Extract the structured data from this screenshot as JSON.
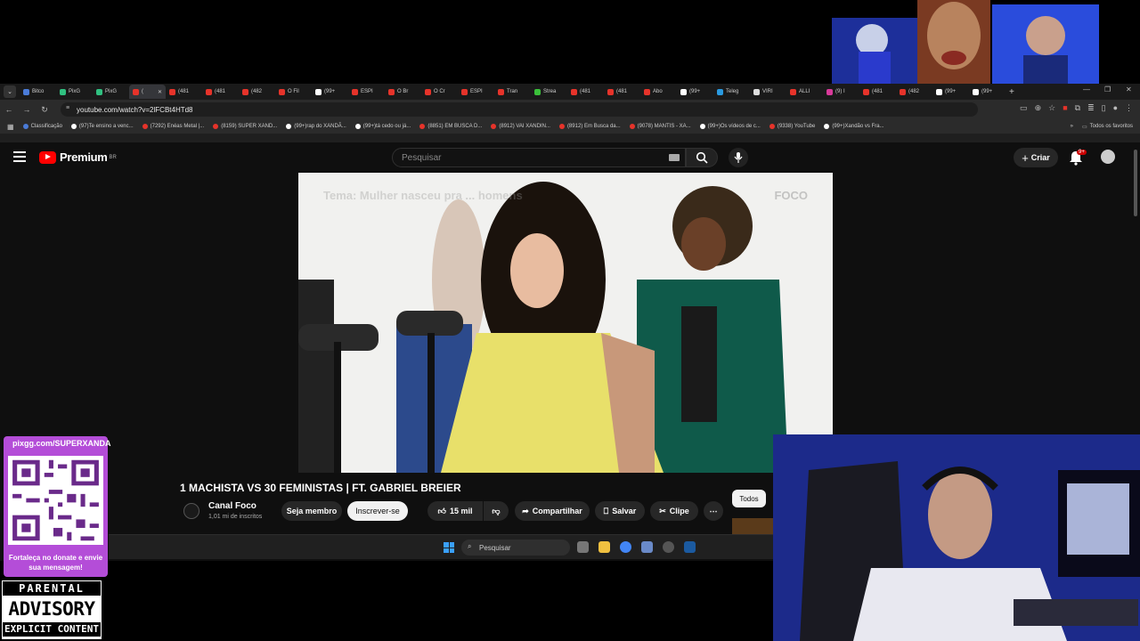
{
  "browser": {
    "tabs": [
      {
        "label": "Bitco",
        "color": "#4a7bd8"
      },
      {
        "label": "PixG",
        "color": "#30c080"
      },
      {
        "label": "PixG",
        "color": "#30c080"
      },
      {
        "label": "(",
        "color": "#e6332a",
        "active": true
      },
      {
        "label": "(481",
        "color": "#e6332a"
      },
      {
        "label": "(481",
        "color": "#e6332a"
      },
      {
        "label": "(482",
        "color": "#e6332a"
      },
      {
        "label": "O Fil",
        "color": "#e6332a"
      },
      {
        "label": "(99+",
        "color": "#ffffff"
      },
      {
        "label": "ESPI",
        "color": "#e6332a"
      },
      {
        "label": "O Br",
        "color": "#e6332a"
      },
      {
        "label": "O Cr",
        "color": "#e6332a"
      },
      {
        "label": "ESPI",
        "color": "#e6332a"
      },
      {
        "label": "Tran",
        "color": "#e6332a"
      },
      {
        "label": "Strea",
        "color": "#3ac03a"
      },
      {
        "label": "(481",
        "color": "#e6332a"
      },
      {
        "label": "(481",
        "color": "#e6332a"
      },
      {
        "label": "Abo",
        "color": "#e6332a"
      },
      {
        "label": "(99+",
        "color": "#ffffff"
      },
      {
        "label": "Teleg",
        "color": "#2a9ae0"
      },
      {
        "label": "VIRI",
        "color": "#dddddd"
      },
      {
        "label": "ALLI",
        "color": "#e6332a"
      },
      {
        "label": "(9) I",
        "color": "#d83a9a"
      },
      {
        "label": "(481",
        "color": "#e6332a"
      },
      {
        "label": "(482",
        "color": "#e6332a"
      },
      {
        "label": "(99+",
        "color": "#ffffff"
      },
      {
        "label": "(99+",
        "color": "#ffffff"
      }
    ],
    "new_tab": "+",
    "url": "youtube.com/watch?v=2lFCBt4HTd8",
    "bookmarks": [
      {
        "label": "Classificação",
        "color": "#4a7bd8"
      },
      {
        "label": "(97)Te ensino a venc...",
        "color": "#ffffff"
      },
      {
        "label": "(7292) Enéas Metal |...",
        "color": "#e6332a"
      },
      {
        "label": "(8159) SUPER XAND...",
        "color": "#e6332a"
      },
      {
        "label": "(99+)rap do XANDÃ...",
        "color": "#ffffff"
      },
      {
        "label": "(99+)tá cedo ou já...",
        "color": "#ffffff"
      },
      {
        "label": "(8851) EM BUSCA D...",
        "color": "#e6332a"
      },
      {
        "label": "(8912) VAI XANDIN...",
        "color": "#e6332a"
      },
      {
        "label": "(8912) Em Busca da...",
        "color": "#e6332a"
      },
      {
        "label": "(9078) MANTIS - XA...",
        "color": "#e6332a"
      },
      {
        "label": "(99+)Os vídeos de c...",
        "color": "#ffffff"
      },
      {
        "label": "(9338) YouTube",
        "color": "#e6332a"
      },
      {
        "label": "(99+)Xandão vs Fra...",
        "color": "#ffffff"
      }
    ],
    "all_favorites": "Todos os favoritos"
  },
  "youtube": {
    "logo_word": "Premium",
    "logo_region": "BR",
    "search_placeholder": "Pesquisar",
    "create_label": "Criar",
    "notif_badge": "9+",
    "video_caption": "Tema: Mulher nasceu pra ... homens",
    "video_watermark": "FOCO",
    "title": "1 MACHISTA VS 30 FEMINISTAS | FT. GABRIEL BREIER",
    "channel_name": "Canal Foco",
    "channel_subs": "1,01 mi de inscritos",
    "member_label": "Seja membro",
    "subscribe_label": "Inscrever-se",
    "likes": "15 mil",
    "share_label": "Compartilhar",
    "save_label": "Salvar",
    "clip_label": "Clipe",
    "chip_all": "Todos"
  },
  "taskbar": {
    "search_placeholder": "Pesquisar"
  },
  "overlay": {
    "donate_url": "pixgg.com/SUPERXANDA",
    "donate_msg": "Fortaleça no donate e envie sua mensagem!",
    "advisory_line1": "PARENTAL",
    "advisory_line2": "ADVISORY",
    "advisory_line3": "EXPLICIT CONTENT"
  },
  "colors": {
    "youtube_red": "#ff0000",
    "qr_panel": "#b44dd8"
  }
}
